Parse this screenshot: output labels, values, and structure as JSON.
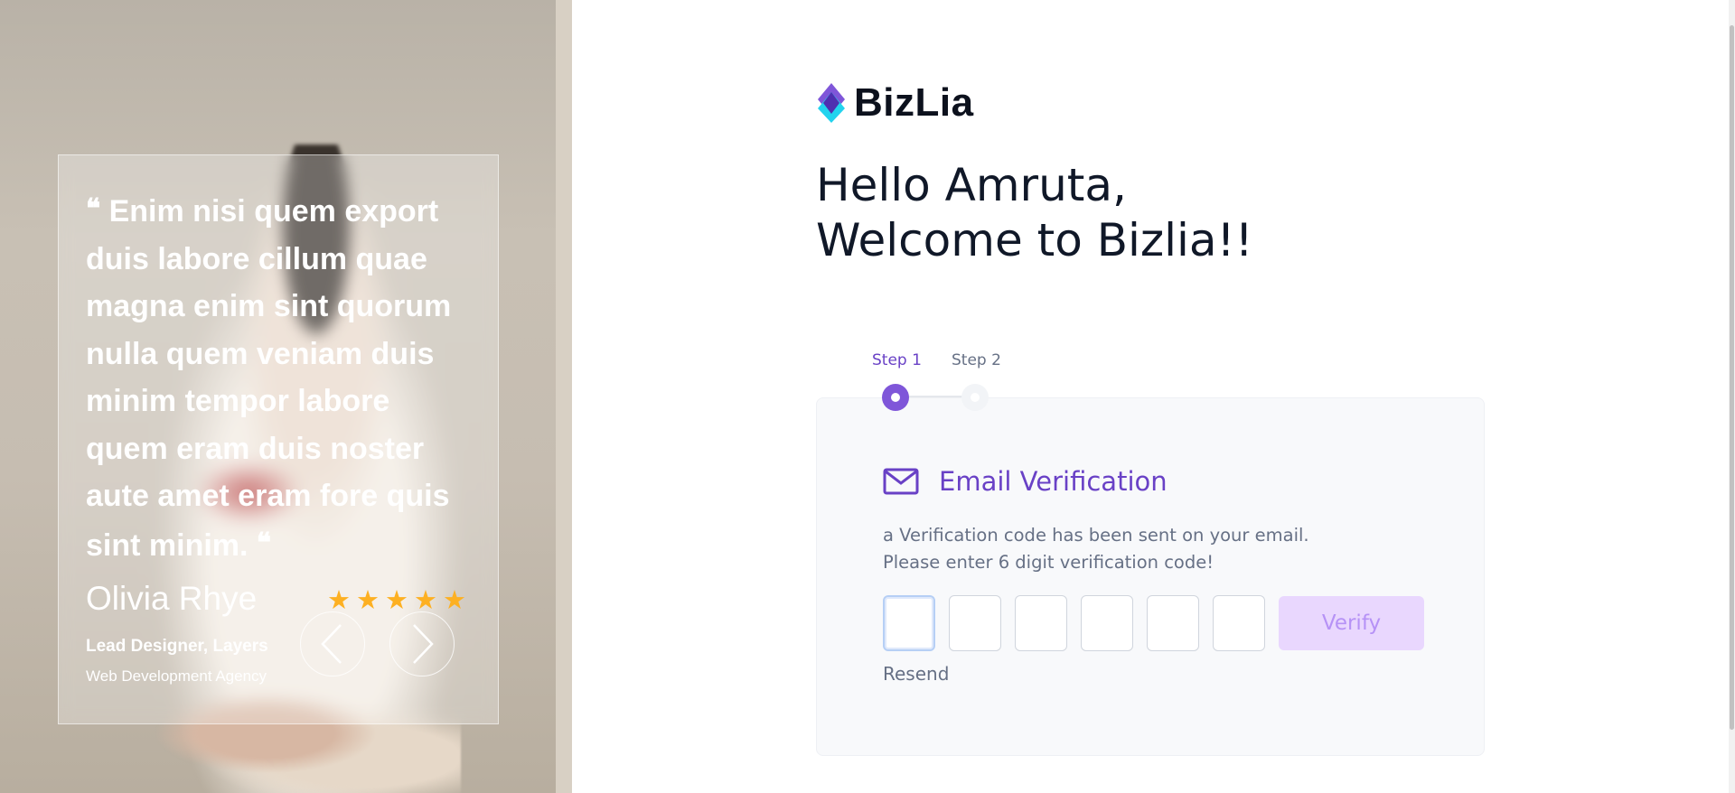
{
  "testimonial": {
    "quote": "Enim nisi quem export duis labore cillum quae magna enim sint quorum nulla quem veniam duis minim tempor labore quem eram duis noster aute amet eram fore quis sint minim.",
    "author_name": "Olivia Rhye",
    "author_role": "Lead Designer, Layers",
    "author_agency": "Web Development Agency",
    "rating": 5,
    "prev_icon": "chevron-left-icon",
    "next_icon": "chevron-right-icon"
  },
  "brand": {
    "name": "BizLia",
    "logo_icon": "diamond-logo-icon",
    "accent_color": "#6941c6"
  },
  "greeting": {
    "line1": "Hello Amruta,",
    "line2": "Welcome to Bizlia!!"
  },
  "steps": [
    {
      "label": "Step 1",
      "active": true
    },
    {
      "label": "Step 2",
      "active": false
    }
  ],
  "verification": {
    "icon": "mail-icon",
    "title": "Email Verification",
    "desc_line1": "a Verification code has been sent on your email.",
    "desc_line2": "Please enter 6 digit verification code!",
    "code_digits": [
      "",
      "",
      "",
      "",
      "",
      ""
    ],
    "verify_label": "Verify",
    "resend_label": "Resend"
  }
}
